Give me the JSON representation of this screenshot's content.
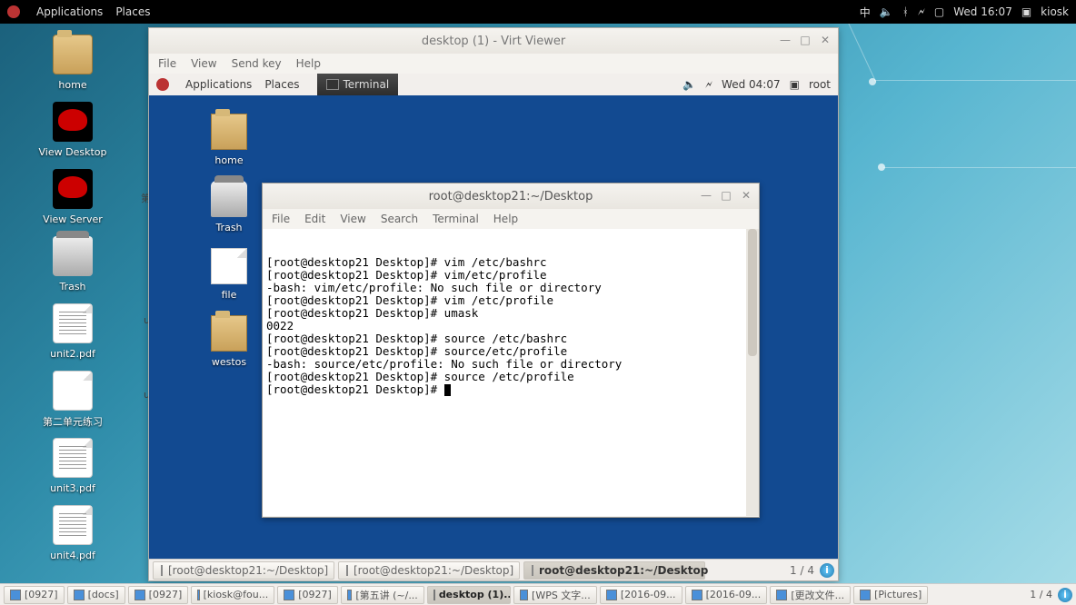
{
  "host_panel": {
    "applications": "Applications",
    "places": "Places",
    "ime": "中",
    "time": "Wed 16:07",
    "user": "kiosk"
  },
  "host_icons": {
    "home": "home",
    "view_desktop": "View Desktop",
    "view_server": "View Server",
    "trash": "Trash",
    "unit2": "unit2.pdf",
    "second_unit": "第二单元练习",
    "unit3": "unit3.pdf",
    "unit4": "unit4.pdf"
  },
  "cut_hints": {
    "a": "第",
    "b": "u",
    "c": "u"
  },
  "virt_viewer": {
    "title": "desktop (1) - Virt Viewer",
    "menu": {
      "file": "File",
      "view": "View",
      "sendkey": "Send key",
      "help": "Help"
    }
  },
  "guest_panel": {
    "applications": "Applications",
    "places": "Places",
    "terminal_tab": "Terminal",
    "time": "Wed 04:07",
    "user": "root"
  },
  "guest_icons": {
    "home": "home",
    "trash": "Trash",
    "file": "file",
    "westos": "westos"
  },
  "terminal": {
    "title": "root@desktop21:~/Desktop",
    "menu": {
      "file": "File",
      "edit": "Edit",
      "view": "View",
      "search": "Search",
      "terminal": "Terminal",
      "help": "Help"
    },
    "lines": [
      "[root@desktop21 Desktop]# vim /etc/bashrc",
      "[root@desktop21 Desktop]# vim/etc/profile",
      "-bash: vim/etc/profile: No such file or directory",
      "[root@desktop21 Desktop]# vim /etc/profile",
      "[root@desktop21 Desktop]# umask",
      "0022",
      "[root@desktop21 Desktop]# source /etc/bashrc",
      "[root@desktop21 Desktop]# source/etc/profile",
      "-bash: source/etc/profile: No such file or directory",
      "[root@desktop21 Desktop]# source /etc/profile",
      "[root@desktop21 Desktop]# "
    ]
  },
  "guest_taskbar": {
    "items": [
      {
        "label": "[root@desktop21:~/Desktop]",
        "active": false
      },
      {
        "label": "[root@desktop21:~/Desktop]",
        "active": false
      },
      {
        "label": "root@desktop21:~/Desktop",
        "active": true
      }
    ],
    "workspace": "1 / 4"
  },
  "host_taskbar": {
    "items": [
      {
        "label": "[0927]"
      },
      {
        "label": "[docs]"
      },
      {
        "label": "[0927]"
      },
      {
        "label": "[kiosk@fou..."
      },
      {
        "label": "[0927]"
      },
      {
        "label": "[第五讲 (~/..."
      },
      {
        "label": "desktop (1)...",
        "active": true
      },
      {
        "label": "[WPS 文字..."
      },
      {
        "label": "[2016-09..."
      },
      {
        "label": "[2016-09..."
      },
      {
        "label": "[更改文件..."
      },
      {
        "label": "[Pictures]"
      }
    ],
    "workspace": "1 / 4"
  }
}
